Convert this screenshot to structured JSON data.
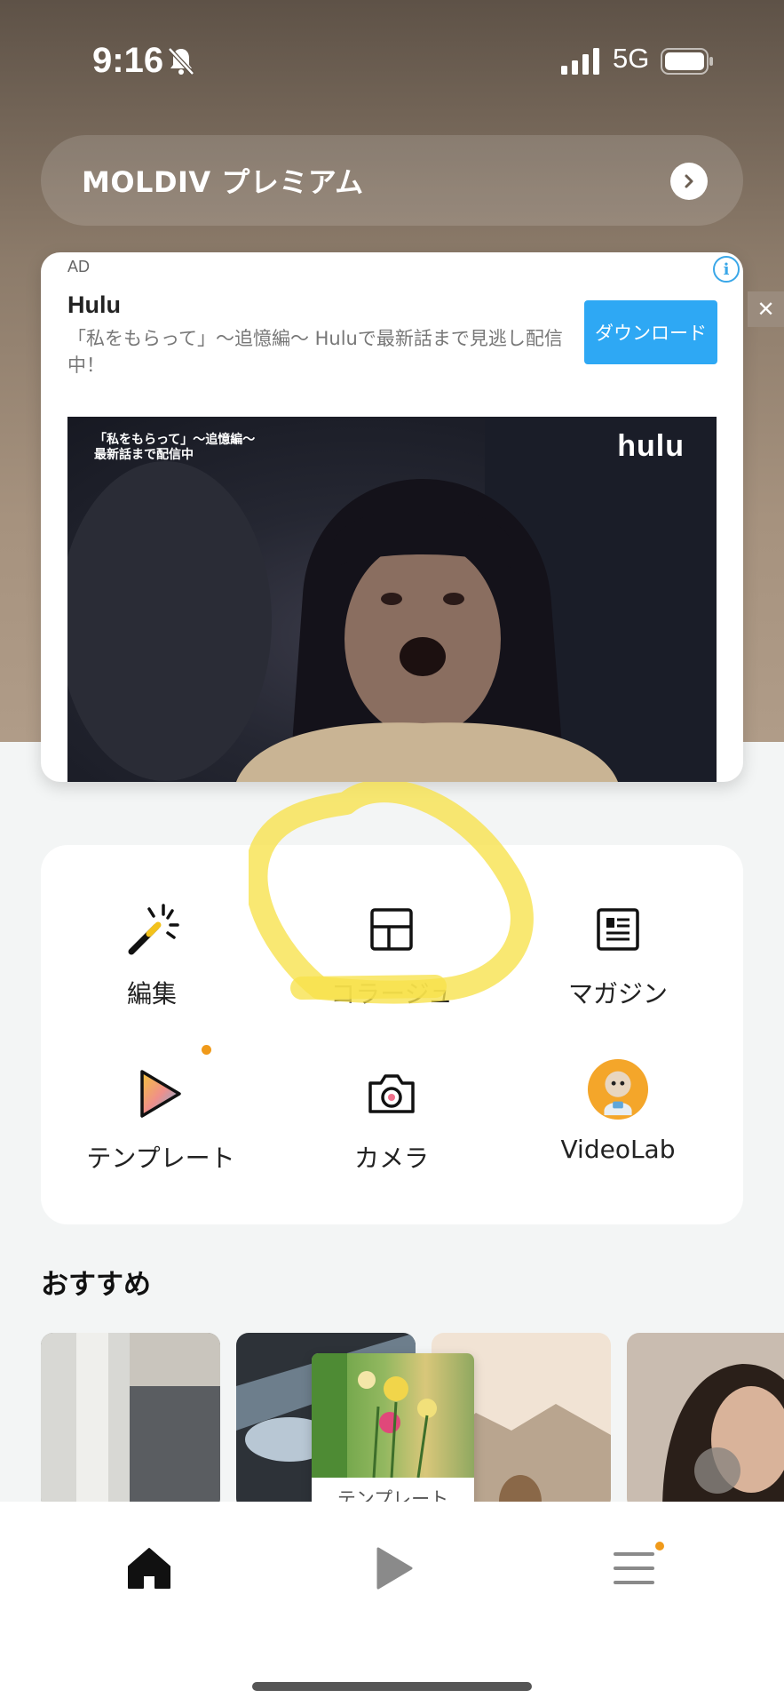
{
  "status_bar": {
    "time": "9:16",
    "network": "5G",
    "icons": [
      "bell-slash-icon",
      "signal-icon",
      "battery-icon"
    ]
  },
  "premium_banner": {
    "label": "MOLDIV プレミアム",
    "icon": "chevron-right-icon"
  },
  "ad": {
    "tag": "AD",
    "info_icon": "i",
    "title": "Hulu",
    "description": "「私をもらって」〜追憶編〜 Huluで最新話まで見逃し配信中！",
    "download_label": "ダウンロード",
    "video_caption_line1": "「私をもらって」〜追憶編〜",
    "video_caption_line2": "最新話まで配信中",
    "video_logo": "hulu",
    "close_label": "✕"
  },
  "menu": {
    "items": [
      {
        "label": "編集",
        "icon": "magic-wand-icon"
      },
      {
        "label": "コラージュ",
        "icon": "collage-icon"
      },
      {
        "label": "マガジン",
        "icon": "magazine-icon"
      },
      {
        "label": "テンプレート",
        "icon": "play-gradient-icon"
      },
      {
        "label": "カメラ",
        "icon": "camera-icon"
      },
      {
        "label": "VideoLab",
        "icon": "videolab-avatar-icon"
      }
    ],
    "highlight_color": "#f7e24a"
  },
  "recommendations": {
    "title": "おすすめ",
    "thumbnails": [
      "street-photo",
      "tunnel-photo",
      "mountain-photo",
      "portrait-photo"
    ]
  },
  "tooltip": {
    "label": "テンプレート"
  },
  "tabbar": {
    "tabs": [
      {
        "name": "home",
        "icon": "home-icon"
      },
      {
        "name": "template",
        "icon": "play-icon"
      },
      {
        "name": "menu",
        "icon": "menu-icon"
      }
    ],
    "accent": "#f09a1a"
  }
}
